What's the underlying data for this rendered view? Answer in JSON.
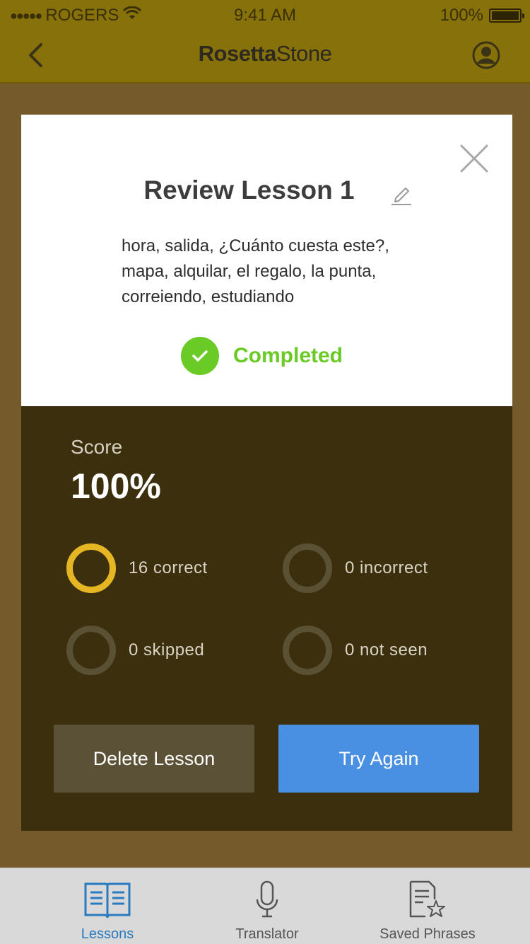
{
  "status_bar": {
    "signal_dots": "●●●●●",
    "carrier": "ROGERS",
    "time": "9:41 AM",
    "battery_percent": "100%",
    "battery_level": 1.0
  },
  "nav": {
    "back_icon": "chevron-left-icon",
    "brand_bold": "Rosetta",
    "brand_light": "Stone",
    "profile_icon": "user-circle-icon"
  },
  "lesson": {
    "title": "Review Lesson 1",
    "words": "hora, salida, ¿Cuánto cuesta este?, mapa, alquilar, el regalo, la punta, correiendo, estudiando",
    "status": "Completed",
    "status_color": "#6bcb26"
  },
  "results": {
    "score_label": "Score",
    "score_value": "100%",
    "stats": {
      "correct": "16 correct",
      "incorrect": "0 incorrect",
      "skipped": "0 skipped",
      "not_seen": "0 not seen"
    },
    "accent_color": "#e6b523"
  },
  "actions": {
    "delete_label": "Delete Lesson",
    "retry_label": "Try Again",
    "retry_color": "#4a90e2"
  },
  "tabs": [
    {
      "label": "Lessons",
      "icon": "book-icon",
      "active": true
    },
    {
      "label": "Translator",
      "icon": "microphone-icon",
      "active": false
    },
    {
      "label": "Saved Phrases",
      "icon": "document-star-icon",
      "active": false
    }
  ]
}
